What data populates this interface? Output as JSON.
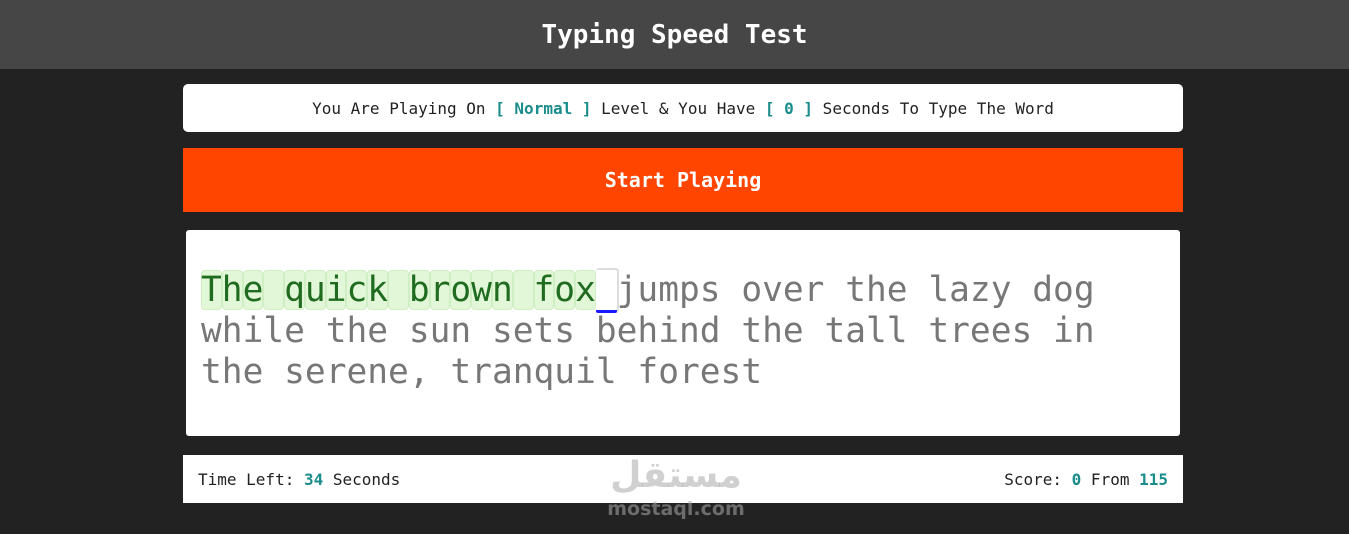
{
  "header": {
    "title": "Typing Speed Test"
  },
  "info": {
    "prefix": "You Are Playing On ",
    "level_open": "[ ",
    "level": "Normal",
    "level_close": " ]",
    "middle": " Level & You Have ",
    "seconds_open": "[ ",
    "seconds": "0",
    "seconds_close": " ]",
    "suffix": " Seconds To Type The Word"
  },
  "start_button": {
    "label": "Start Playing"
  },
  "typing": {
    "sentence": "The quick brown fox jumps over the lazy dog while the sun sets behind the tall trees in the serene, tranquil forest",
    "typed_count": 19,
    "colors": {
      "typed": "#1f6b1f",
      "typed_bg": "#e2f7d8",
      "pending": "#777777",
      "cursor": "#1a1aff"
    }
  },
  "status": {
    "time_label": "Time Left: ",
    "time_value": "34",
    "time_unit": " Seconds",
    "score_label": "Score: ",
    "score_value": "0",
    "score_from": " From ",
    "score_total": "115"
  },
  "watermark": {
    "arabic": "مستقل",
    "latin": "mostaql.com"
  },
  "colors": {
    "accent": "#1a8c8c",
    "button": "#ff4500",
    "header_bg": "#464646",
    "page_bg": "#222222"
  }
}
